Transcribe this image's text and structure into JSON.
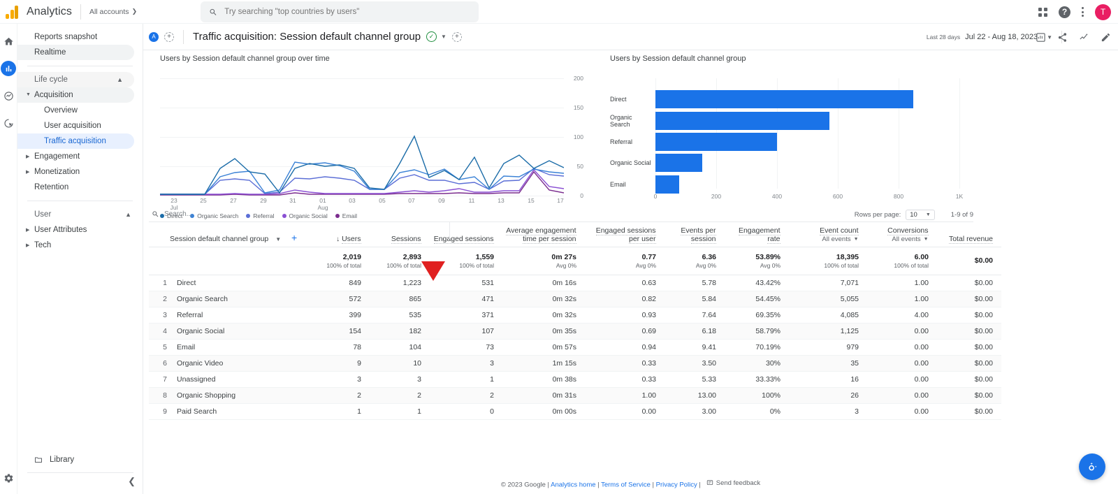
{
  "topbar": {
    "brand": "Analytics",
    "account_label": "All accounts",
    "account_chevron": "chevron-right",
    "search_placeholder": "Try searching \"top countries by users\"",
    "avatar_initial": "T",
    "help_glyph": "?"
  },
  "sidebar": {
    "items": [
      {
        "label": "Reports snapshot",
        "type": "item"
      },
      {
        "label": "Realtime",
        "type": "item"
      },
      {
        "label": "Life cycle",
        "type": "group"
      },
      {
        "label": "Acquisition",
        "type": "parent"
      },
      {
        "label": "Overview",
        "type": "sub"
      },
      {
        "label": "User acquisition",
        "type": "sub"
      },
      {
        "label": "Traffic acquisition",
        "type": "sub-selected"
      },
      {
        "label": "Engagement",
        "type": "parent-collapsed"
      },
      {
        "label": "Monetization",
        "type": "parent-collapsed"
      },
      {
        "label": "Retention",
        "type": "item"
      },
      {
        "label": "User",
        "type": "group"
      },
      {
        "label": "User Attributes",
        "type": "parent-collapsed"
      },
      {
        "label": "Tech",
        "type": "parent-collapsed"
      }
    ],
    "library_label": "Library"
  },
  "header": {
    "badge": "A",
    "title": "Traffic acquisition: Session default channel group",
    "date_label": "Last 28 days",
    "date_range": "Jul 22 - Aug 18, 2023"
  },
  "charts": {
    "line_title": "Users by Session default channel group over time",
    "bar_title": "Users by Session default channel group"
  },
  "chart_data": [
    {
      "type": "line",
      "title": "Users by Session default channel group over time",
      "xlabel": "",
      "ylabel": "",
      "ylim": [
        0,
        200
      ],
      "yticks": [
        0,
        50,
        100,
        150,
        200
      ],
      "grid": true,
      "legend_position": "bottom",
      "x": [
        "22 Jul",
        "23 Jul",
        "24 Jul",
        "25 Jul",
        "26 Jul",
        "27 Jul",
        "28 Jul",
        "29 Jul",
        "30 Jul",
        "31 Jul",
        "01 Aug",
        "02 Aug",
        "03 Aug",
        "04 Aug",
        "05 Aug",
        "06 Aug",
        "07 Aug",
        "08 Aug",
        "09 Aug",
        "10 Aug",
        "11 Aug",
        "12 Aug",
        "13 Aug",
        "14 Aug",
        "15 Aug",
        "16 Aug",
        "17 Aug",
        "18 Aug"
      ],
      "xtick_labels": [
        "23\nJul",
        "25",
        "27",
        "29",
        "31",
        "01\nAug",
        "03",
        "05",
        "07",
        "09",
        "11",
        "13",
        "15",
        "17"
      ],
      "series": [
        {
          "name": "Direct",
          "color": "#1b6ca8",
          "values": [
            2,
            2,
            2,
            2,
            46,
            62,
            40,
            36,
            4,
            44,
            54,
            49,
            52,
            44,
            12,
            10,
            54,
            100,
            30,
            42,
            26,
            64,
            12,
            54,
            68,
            44,
            58,
            46
          ]
        },
        {
          "name": "Organic Search",
          "color": "#3b82d6",
          "values": [
            2,
            2,
            2,
            2,
            30,
            36,
            38,
            4,
            8,
            56,
            52,
            54,
            50,
            38,
            12,
            12,
            36,
            42,
            32,
            44,
            26,
            30,
            12,
            32,
            30,
            44,
            40,
            38
          ]
        },
        {
          "name": "Referral",
          "color": "#5b6ed6",
          "values": [
            2,
            2,
            2,
            2,
            26,
            28,
            26,
            4,
            6,
            30,
            28,
            32,
            30,
            26,
            10,
            10,
            30,
            36,
            26,
            26,
            20,
            22,
            10,
            24,
            26,
            46,
            34,
            32
          ]
        },
        {
          "name": "Organic Social",
          "color": "#8a4fd3",
          "values": [
            1,
            1,
            1,
            1,
            2,
            4,
            2,
            1,
            3,
            10,
            6,
            4,
            4,
            4,
            3,
            3,
            6,
            8,
            6,
            8,
            12,
            6,
            6,
            8,
            8,
            44,
            16,
            12
          ]
        },
        {
          "name": "Email",
          "color": "#7b2d8e",
          "values": [
            1,
            1,
            1,
            1,
            1,
            2,
            1,
            1,
            1,
            3,
            2,
            2,
            2,
            2,
            2,
            2,
            3,
            3,
            3,
            3,
            4,
            3,
            3,
            4,
            4,
            40,
            10,
            4
          ]
        }
      ]
    },
    {
      "type": "bar",
      "orientation": "horizontal",
      "title": "Users by Session default channel group",
      "categories": [
        "Direct",
        "Organic Search",
        "Referral",
        "Organic Social",
        "Email"
      ],
      "values": [
        849,
        572,
        399,
        154,
        78
      ],
      "color": "#1a73e8",
      "xlim": [
        0,
        1000
      ],
      "xticks": [
        0,
        200,
        400,
        600,
        800
      ],
      "xtick_labels": [
        "0",
        "200",
        "400",
        "600",
        "800",
        "1K"
      ],
      "ylabel": "",
      "xlabel": ""
    }
  ],
  "table": {
    "search_placeholder": "Search...",
    "rows_per_page_label": "Rows per page:",
    "rows_per_page_value": "10",
    "range_label": "1-9 of 9",
    "dimension_header": "Session default channel group",
    "columns": [
      {
        "label": "Users",
        "sorted": true,
        "sub": ""
      },
      {
        "label": "Sessions",
        "sub": ""
      },
      {
        "label": "Engaged sessions",
        "sub": ""
      },
      {
        "label": "Average engagement time per session",
        "sub": ""
      },
      {
        "label": "Engaged sessions per user",
        "sub": ""
      },
      {
        "label": "Events per session",
        "sub": ""
      },
      {
        "label": "Engagement rate",
        "sub": ""
      },
      {
        "label": "Event count",
        "sub": "All events"
      },
      {
        "label": "Conversions",
        "sub": "All events"
      },
      {
        "label": "Total revenue",
        "sub": ""
      }
    ],
    "totals": [
      {
        "value": "2,019",
        "note": "100% of total"
      },
      {
        "value": "2,893",
        "note": "100% of total"
      },
      {
        "value": "1,559",
        "note": "100% of total"
      },
      {
        "value": "0m 27s",
        "note": "Avg 0%"
      },
      {
        "value": "0.77",
        "note": "Avg 0%"
      },
      {
        "value": "6.36",
        "note": "Avg 0%"
      },
      {
        "value": "53.89%",
        "note": "Avg 0%"
      },
      {
        "value": "18,395",
        "note": "100% of total"
      },
      {
        "value": "6.00",
        "note": "100% of total"
      },
      {
        "value": "$0.00",
        "note": ""
      }
    ],
    "rows": [
      {
        "index": "1",
        "dimension": "Direct",
        "cells": [
          "849",
          "1,223",
          "531",
          "0m 16s",
          "0.63",
          "5.78",
          "43.42%",
          "7,071",
          "1.00",
          "$0.00"
        ]
      },
      {
        "index": "2",
        "dimension": "Organic Search",
        "cells": [
          "572",
          "865",
          "471",
          "0m 32s",
          "0.82",
          "5.84",
          "54.45%",
          "5,055",
          "1.00",
          "$0.00"
        ]
      },
      {
        "index": "3",
        "dimension": "Referral",
        "cells": [
          "399",
          "535",
          "371",
          "0m 32s",
          "0.93",
          "7.64",
          "69.35%",
          "4,085",
          "4.00",
          "$0.00"
        ]
      },
      {
        "index": "4",
        "dimension": "Organic Social",
        "cells": [
          "154",
          "182",
          "107",
          "0m 35s",
          "0.69",
          "6.18",
          "58.79%",
          "1,125",
          "0.00",
          "$0.00"
        ]
      },
      {
        "index": "5",
        "dimension": "Email",
        "cells": [
          "78",
          "104",
          "73",
          "0m 57s",
          "0.94",
          "9.41",
          "70.19%",
          "979",
          "0.00",
          "$0.00"
        ]
      },
      {
        "index": "6",
        "dimension": "Organic Video",
        "cells": [
          "9",
          "10",
          "3",
          "1m 15s",
          "0.33",
          "3.50",
          "30%",
          "35",
          "0.00",
          "$0.00"
        ]
      },
      {
        "index": "7",
        "dimension": "Unassigned",
        "cells": [
          "3",
          "3",
          "1",
          "0m 38s",
          "0.33",
          "5.33",
          "33.33%",
          "16",
          "0.00",
          "$0.00"
        ]
      },
      {
        "index": "8",
        "dimension": "Organic Shopping",
        "cells": [
          "2",
          "2",
          "2",
          "0m 31s",
          "1.00",
          "13.00",
          "100%",
          "26",
          "0.00",
          "$0.00"
        ]
      },
      {
        "index": "9",
        "dimension": "Paid Search",
        "cells": [
          "1",
          "1",
          "0",
          "0m 00s",
          "0.00",
          "3.00",
          "0%",
          "3",
          "0.00",
          "$0.00"
        ]
      }
    ]
  },
  "footer": {
    "copyright": "© 2023 Google",
    "links": [
      "Analytics home",
      "Terms of Service",
      "Privacy Policy"
    ],
    "feedback": "Send feedback"
  },
  "colors": {
    "accent": "#1a73e8",
    "bar": "#1a73e8",
    "selected_bg": "#e8f0fe",
    "avatar": "#e91e63",
    "annotation_arrow": "#e02020"
  }
}
